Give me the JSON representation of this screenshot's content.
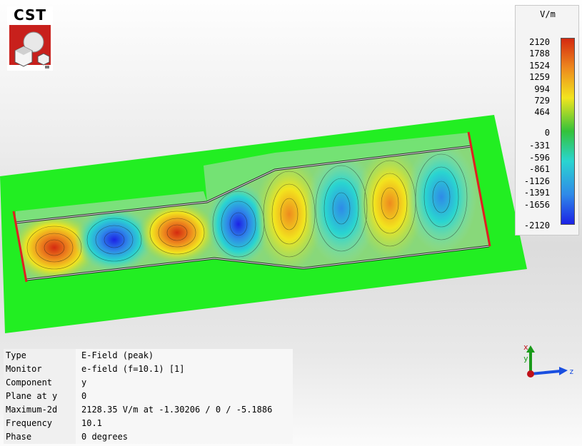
{
  "logo": {
    "text": "CST"
  },
  "legend": {
    "unit": "V/m",
    "ticks": [
      "2120",
      "1788",
      "1524",
      "1259",
      "994",
      "729",
      "464",
      "0",
      "-331",
      "-596",
      "-861",
      "-1126",
      "-1391",
      "-1656",
      "-2120"
    ],
    "colors": {
      "max": "#d42a10",
      "high": "#ee8a1e",
      "mid_high": "#f2e51e",
      "zero": "#34c23a",
      "mid_low": "#2ad5d0",
      "low": "#2f8ae8",
      "min": "#1c22e6"
    }
  },
  "info": [
    {
      "label": "Type",
      "value": "E-Field (peak)"
    },
    {
      "label": "Monitor",
      "value": "e-field (f=10.1) [1]"
    },
    {
      "label": "Component",
      "value": "y"
    },
    {
      "label": "Plane at y",
      "value": "0"
    },
    {
      "label": "Maximum-2d",
      "value": "2128.35 V/m at -1.30206 / 0 / -5.1886"
    },
    {
      "label": "Frequency",
      "value": "10.1"
    },
    {
      "label": "Phase",
      "value": "0 degrees"
    }
  ],
  "axes": {
    "x": "x",
    "y": "y",
    "z": "z"
  },
  "scene": {
    "background_plane_color": "#22ee22",
    "port_color": "#e02020"
  }
}
